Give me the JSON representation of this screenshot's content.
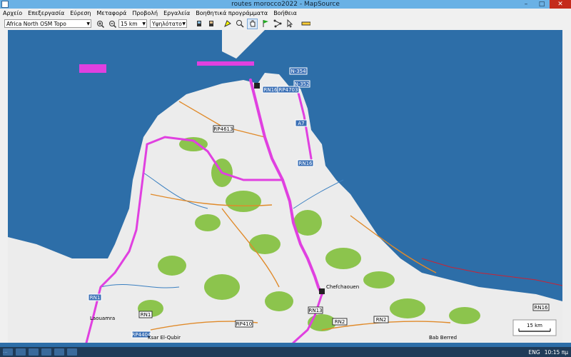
{
  "window": {
    "title": "routes morocco2022 - MapSource",
    "minimize": "–",
    "maximize": "□",
    "close": "✕"
  },
  "menu": [
    "Αρχείο",
    "Επεξεργασία",
    "Εύρεση",
    "Μεταφορά",
    "Προβολή",
    "Εργαλεία",
    "Βοηθητικά προγράμματα",
    "Βοήθεια"
  ],
  "toolbar": {
    "map_product": "Africa North OSM Topo",
    "scale": "15 km",
    "detail": "Υψηλότατο"
  },
  "colors": {
    "sea": "#2d6ea8",
    "land": "#ececec",
    "route": "#e040e0",
    "forest": "#8cc44d"
  },
  "map": {
    "road_shields": [
      {
        "text": "N-354",
        "type": "blue"
      },
      {
        "text": "N-352",
        "type": "blue"
      },
      {
        "text": "RN16",
        "type": "blue"
      },
      {
        "text": "RP4703",
        "type": "blue"
      },
      {
        "text": "RP4613",
        "type": "white"
      },
      {
        "text": "A7",
        "type": "blue"
      },
      {
        "text": "RN16",
        "type": "blue"
      },
      {
        "text": "RN1",
        "type": "blue"
      },
      {
        "text": "RN1",
        "type": "white"
      },
      {
        "text": "RP4404",
        "type": "blue"
      },
      {
        "text": "RN13",
        "type": "white"
      },
      {
        "text": "RP410",
        "type": "white"
      },
      {
        "text": "RN2",
        "type": "white"
      },
      {
        "text": "RN2",
        "type": "white"
      },
      {
        "text": "RN16",
        "type": "white"
      }
    ],
    "places": [
      "Chefchaouen",
      "Ksar El-Qubir",
      "Laouamra",
      "Bab Berred"
    ],
    "scale_label": "15 km"
  },
  "status": {
    "text": "..."
  },
  "tray": {
    "lang": "ENG",
    "time": "10:15 πμ"
  }
}
